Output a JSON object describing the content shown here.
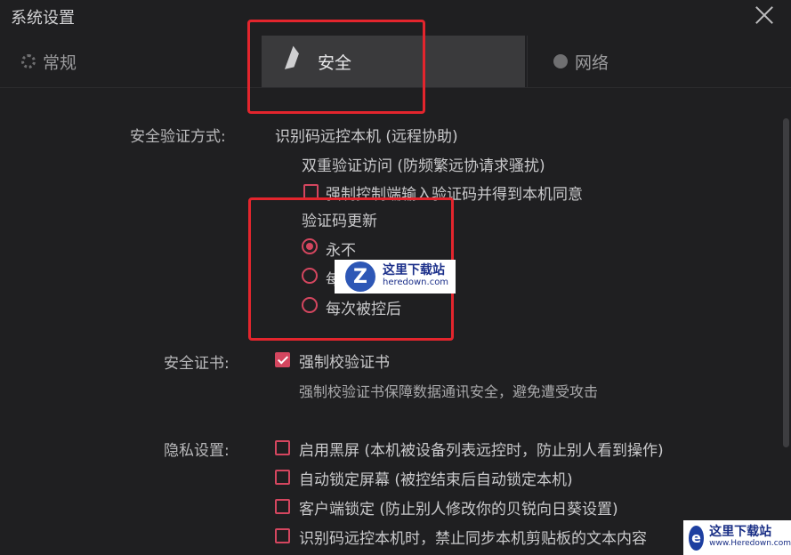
{
  "window": {
    "title": "系统设置"
  },
  "tabs": [
    {
      "label": "常规",
      "icon": "gear-icon"
    },
    {
      "label": "安全",
      "icon": "flag-icon"
    },
    {
      "label": "网络",
      "icon": "globe-icon"
    }
  ],
  "security": {
    "verify_label": "安全验证方式:",
    "verify_value": "识别码远控本机 (远程协助)",
    "double_verify": "双重验证访问 (防频繁远协请求骚扰)",
    "force_code": "强制控制端输入验证码并得到本机同意",
    "code_update_title": "验证码更新",
    "code_update_options": [
      {
        "label": "永不",
        "checked": true
      },
      {
        "label": "每",
        "checked": false
      },
      {
        "label": "每次被控后",
        "checked": false
      }
    ]
  },
  "certificate": {
    "label": "安全证书:",
    "option": "强制校验证书",
    "checked": true,
    "description": "强制校验证书保障数据通讯安全，避免遭受攻击"
  },
  "privacy": {
    "label": "隐私设置:",
    "options": [
      {
        "label": "启用黑屏 (本机被设备列表远控时，防止别人看到操作)",
        "checked": false
      },
      {
        "label": "自动锁定屏幕 (被控结束后自动锁定本机)",
        "checked": false
      },
      {
        "label": "客户端锁定 (防止别人修改你的贝锐向日葵设置)",
        "checked": false
      },
      {
        "label": "识别码远控本机时，禁止同步本机剪贴板的文本内容",
        "checked": false
      }
    ]
  },
  "watermarks": {
    "center_title": "这里下载站",
    "center_url": "heredown.com",
    "corner_title": "这里下载站",
    "corner_url": "www.Heredown.com"
  },
  "colors": {
    "accent": "#d4465f",
    "highlight": "#e3252d",
    "background": "#1f1f21",
    "active_tab": "#3a3a3c"
  }
}
